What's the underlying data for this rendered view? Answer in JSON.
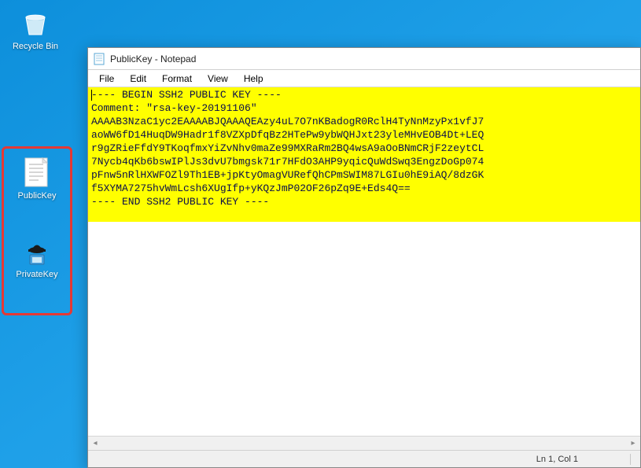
{
  "desktop_icons": {
    "recycle_bin": {
      "label": "Recycle Bin"
    },
    "public_key": {
      "label": "PublicKey"
    },
    "private_key": {
      "label": "PrivateKey"
    }
  },
  "notepad": {
    "title": "PublicKey - Notepad",
    "menu": {
      "file": "File",
      "edit": "Edit",
      "format": "Format",
      "view": "View",
      "help": "Help"
    },
    "content_lines": [
      "---- BEGIN SSH2 PUBLIC KEY ----",
      "Comment: \"rsa-key-20191106\"",
      "AAAAB3NzaC1yc2EAAAABJQAAAQEAzy4uL7O7nKBadogR0RclH4TyNnMzyPx1vfJ7",
      "aoWW6fD14HuqDW9Hadr1f8VZXpDfqBz2HTePw9ybWQHJxt23yleMHvEOB4Dt+LEQ",
      "r9gZRieFfdY9TKoqfmxYiZvNhv0maZe99MXRaRm2BQ4wsA9aOoBNmCRjF2zeytCL",
      "7Nycb4qKb6bswIPlJs3dvU7bmgsk71r7HFdO3AHP9yqicQuWdSwq3EngzDoGp074",
      "pFnw5nRlHXWFOZl9Th1EB+jpKtyOmagVURefQhCPmSWIM87LGIu0hE9iAQ/8dzGK",
      "f5XYMA7275hvWmLcsh6XUgIfp+yKQzJmP02OF26pZq9E+Eds4Q==",
      "---- END SSH2 PUBLIC KEY ----",
      ""
    ],
    "statusbar": {
      "lncol": "Ln 1, Col 1"
    }
  }
}
